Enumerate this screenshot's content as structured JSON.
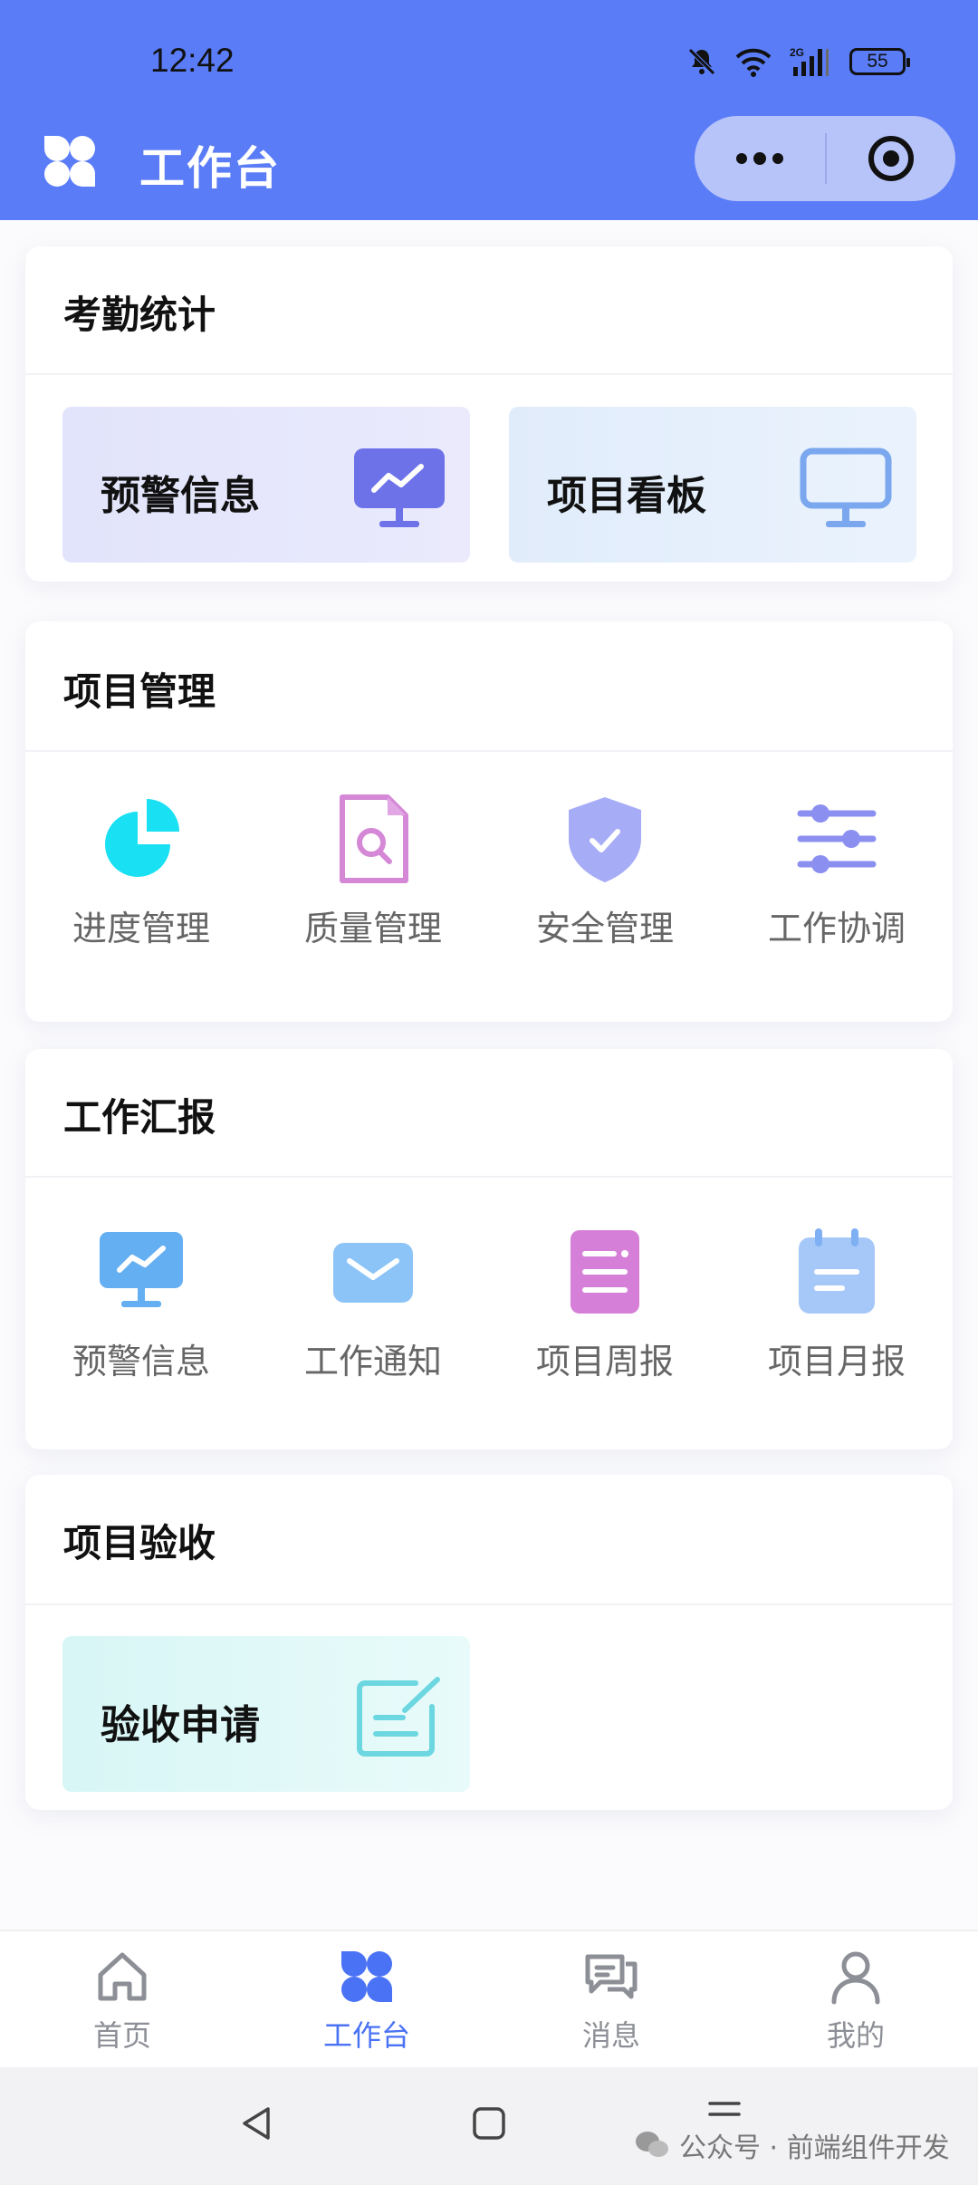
{
  "status_bar": {
    "time": "12:42",
    "battery": "55",
    "network": "2G"
  },
  "header": {
    "title": "工作台",
    "logo_icon": "four-petal-grid-icon",
    "menu_icon": "more-dots-icon",
    "close_icon": "target-circle-icon"
  },
  "sections": [
    {
      "title": "考勤统计",
      "tiles": [
        {
          "label": "预警信息",
          "icon": "monitor-chart-icon"
        },
        {
          "label": "项目看板",
          "icon": "monitor-icon"
        }
      ]
    },
    {
      "title": "项目管理",
      "items": [
        {
          "label": "进度管理",
          "icon": "pie-chart-icon"
        },
        {
          "label": "质量管理",
          "icon": "document-search-icon"
        },
        {
          "label": "安全管理",
          "icon": "shield-check-icon"
        },
        {
          "label": "工作协调",
          "icon": "sliders-icon"
        }
      ]
    },
    {
      "title": "工作汇报",
      "items": [
        {
          "label": "预警信息",
          "icon": "monitor-chart-icon"
        },
        {
          "label": "工作通知",
          "icon": "envelope-icon"
        },
        {
          "label": "项目周报",
          "icon": "report-icon"
        },
        {
          "label": "项目月报",
          "icon": "calendar-icon"
        }
      ]
    },
    {
      "title": "项目验收",
      "tiles": [
        {
          "label": "验收申请",
          "icon": "edit-note-icon"
        }
      ]
    }
  ],
  "bottom_nav": [
    {
      "label": "首页",
      "icon": "home-icon",
      "active": false
    },
    {
      "label": "工作台",
      "icon": "four-petal-grid-icon",
      "active": true
    },
    {
      "label": "消息",
      "icon": "chat-bubbles-icon",
      "active": false
    },
    {
      "label": "我的",
      "icon": "user-icon",
      "active": false
    }
  ],
  "watermark": "公众号 · 前端组件开发",
  "colors": {
    "header": "#5a7cf7",
    "active_nav": "#4a72f5"
  }
}
